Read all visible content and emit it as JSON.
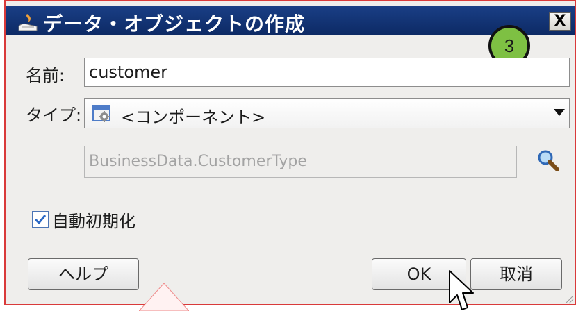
{
  "dialog": {
    "title": "データ・オブジェクトの作成",
    "close_label": "X",
    "step_badge": "3"
  },
  "form": {
    "name_label": "名前:",
    "name_value": "customer",
    "type_label": "タイプ:",
    "type_value": "<コンポーネント>",
    "class_value": "BusinessData.CustomerType",
    "auto_init_label": "自動初期化",
    "auto_init_checked": true
  },
  "buttons": {
    "help": "ヘルプ",
    "ok": "OK",
    "cancel": "取消"
  },
  "colors": {
    "title_bar": "#1a3f86",
    "badge": "#7ec043",
    "dialog_border": "#d93a3a"
  },
  "icons": {
    "title": "hand-flame-icon",
    "type": "component-icon",
    "search": "search-icon",
    "checkbox": "checkmark-icon",
    "cursor": "mouse-pointer-icon"
  }
}
